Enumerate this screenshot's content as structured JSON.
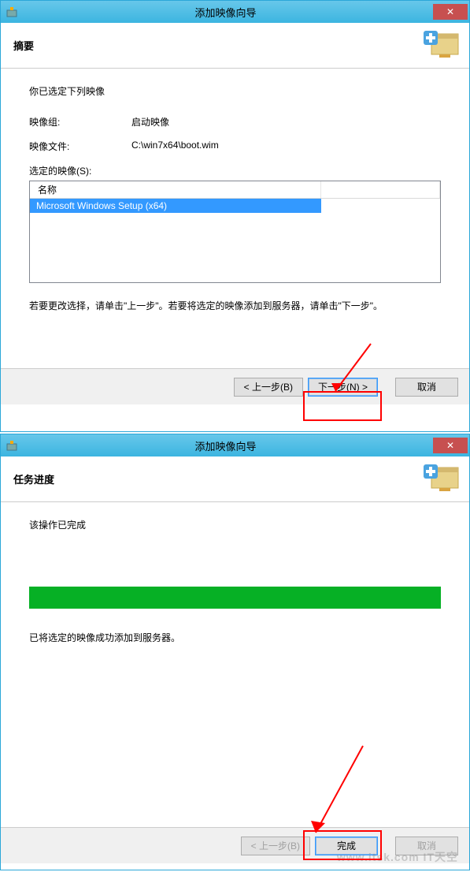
{
  "dialog1": {
    "title": "添加映像向导",
    "header": "摘要",
    "intro": "你已选定下列映像",
    "image_group_label": "映像组:",
    "image_group_value": "启动映像",
    "image_file_label": "映像文件:",
    "image_file_value": "C:\\win7x64\\boot.wim",
    "selected_label": "选定的映像(S):",
    "col_name": "名称",
    "row1": "Microsoft Windows Setup (x64)",
    "instruction": "若要更改选择，请单击\"上一步\"。若要将选定的映像添加到服务器，请单击\"下一步\"。",
    "back": "< 上一步(B)",
    "next": "下一步(N) >",
    "cancel": "取消"
  },
  "dialog2": {
    "title": "添加映像向导",
    "header": "任务进度",
    "status": "该操作已完成",
    "result": "已将选定的映像成功添加到服务器。",
    "back": "< 上一步(B)",
    "finish": "完成",
    "cancel": "取消"
  },
  "watermark": "www.itsk.com IT天空"
}
